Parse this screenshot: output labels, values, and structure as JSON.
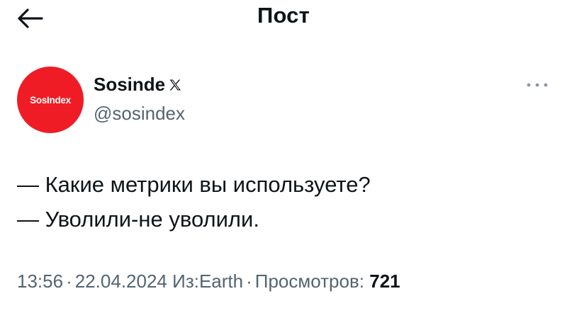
{
  "header": {
    "title": "Пост",
    "back_icon": "arrow-left-icon"
  },
  "author": {
    "avatar_text": "SosIndex",
    "avatar_color": "#ef1c25",
    "name": "Sosinde",
    "name_badge_icon": "x-logo-icon",
    "handle": "@sosindex",
    "more_icon": "more-dots-icon"
  },
  "post": {
    "lines": [
      "— Какие метрики вы используете?",
      "— Уволили-не уволили."
    ]
  },
  "meta": {
    "time": "13:56",
    "separator": "·",
    "date": "22.04.2024",
    "source": "Из:Earth",
    "views_label": "Просмотров:",
    "views_count": "721"
  },
  "colors": {
    "text": "#0f1419",
    "secondary": "#536471",
    "brand_red": "#ef1c25"
  }
}
